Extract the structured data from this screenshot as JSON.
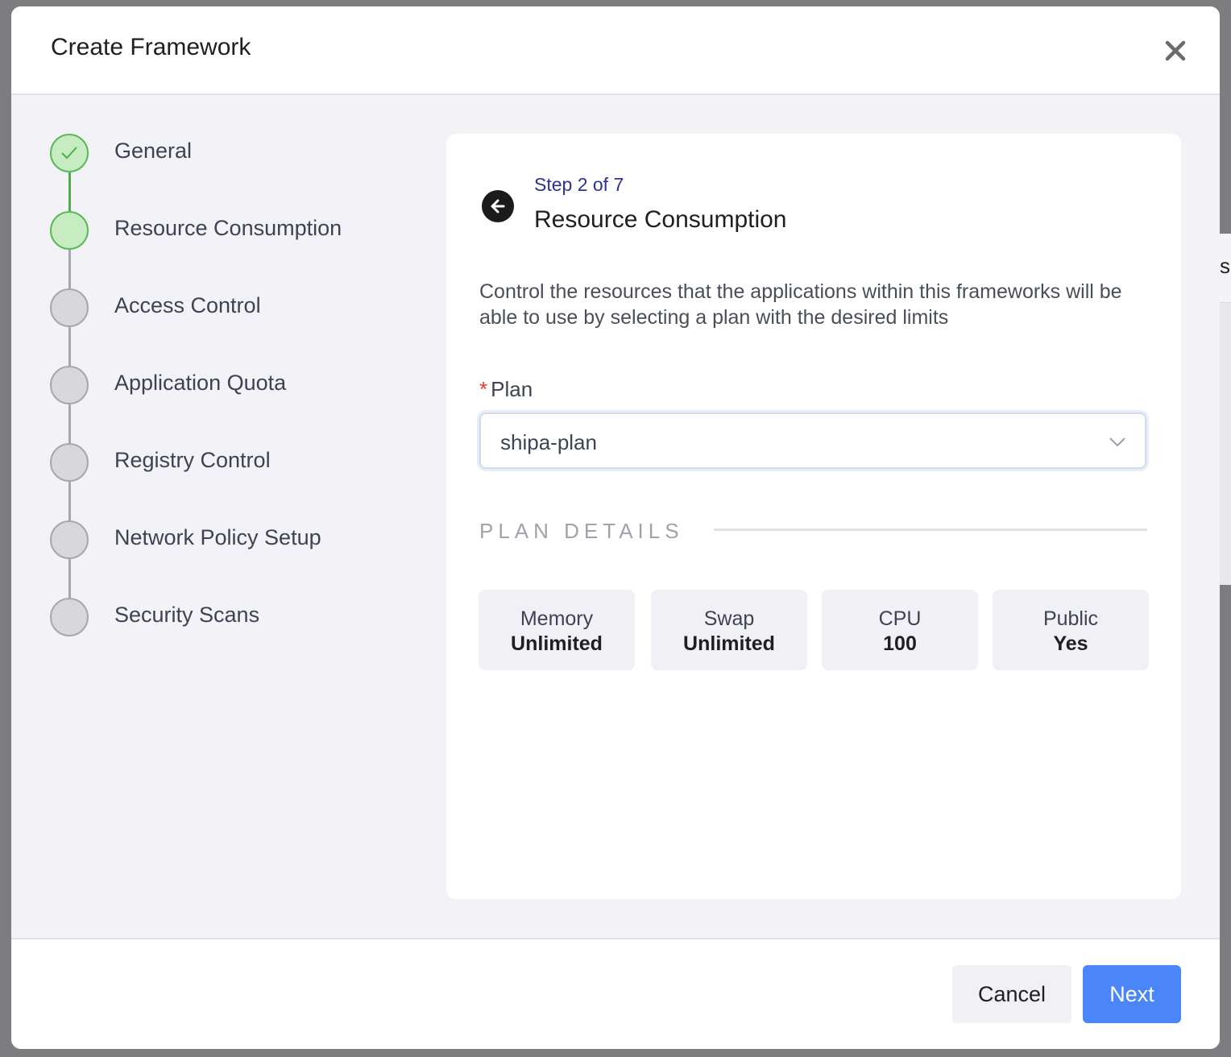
{
  "backdrop": {
    "peek_text": "s"
  },
  "modal": {
    "title": "Create Framework"
  },
  "stepper": {
    "steps": [
      {
        "label": "General",
        "state": "done"
      },
      {
        "label": "Resource Consumption",
        "state": "active"
      },
      {
        "label": "Access Control",
        "state": "pending"
      },
      {
        "label": "Application Quota",
        "state": "pending"
      },
      {
        "label": "Registry Control",
        "state": "pending"
      },
      {
        "label": "Network Policy Setup",
        "state": "pending"
      },
      {
        "label": "Security Scans",
        "state": "pending"
      }
    ]
  },
  "card": {
    "step_counter": "Step 2 of 7",
    "title": "Resource Consumption",
    "description": "Control the resources that the applications within this frameworks will be able to use by selecting a plan with the desired limits",
    "plan_label": "Plan",
    "plan_required_mark": "*",
    "plan_value": "shipa-plan",
    "section_heading": "PLAN DETAILS",
    "details": [
      {
        "name": "Memory",
        "value": "Unlimited"
      },
      {
        "name": "Swap",
        "value": "Unlimited"
      },
      {
        "name": "CPU",
        "value": "100"
      },
      {
        "name": "Public",
        "value": "Yes"
      }
    ]
  },
  "footer": {
    "cancel_label": "Cancel",
    "next_label": "Next"
  },
  "colors": {
    "accent": "#4a86f7",
    "step_done": "#5cb85c",
    "step_counter": "#2e3192",
    "required": "#e53935"
  },
  "icons": {
    "close": "close-icon",
    "back": "arrow-left-icon",
    "check": "check-icon",
    "chevron": "chevron-down-icon"
  }
}
